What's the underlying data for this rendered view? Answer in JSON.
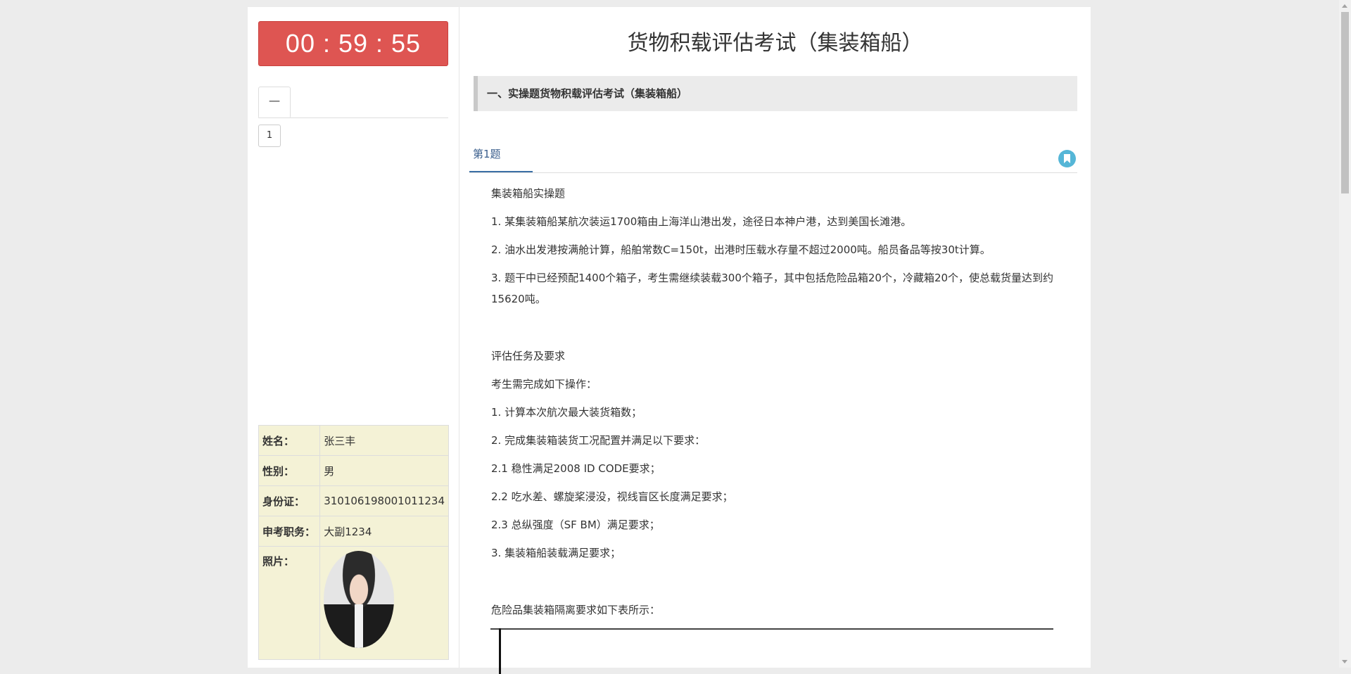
{
  "timer": {
    "value": "00 : 59 : 55"
  },
  "question_nav": {
    "tabs": [
      {
        "label": "一"
      }
    ],
    "buttons": [
      {
        "label": "1"
      }
    ]
  },
  "candidate": {
    "rows": [
      {
        "key": "姓名：",
        "value": "张三丰"
      },
      {
        "key": "性别：",
        "value": "男"
      },
      {
        "key": "身份证：",
        "value": "310106198001011234"
      },
      {
        "key": "申考职务：",
        "value": "大副1234"
      }
    ],
    "photo_label": "照片："
  },
  "exam": {
    "title": "货物积载评估考试（集装箱船）",
    "section_title": "一、实操题货物积载评估考试（集装箱船）",
    "question_label": "第1题",
    "bookmark_icon": "bookmark-icon",
    "paragraphs": [
      "集装箱船实操题",
      "1. 某集装箱船某航次装运1700箱由上海洋山港出发，途径日本神户港，达到美国长滩港。",
      "2. 油水出发港按满舱计算，船舶常数C=150t，出港时压载水存量不超过2000吨。船员备品等按30t计算。",
      "3. 题干中已经预配1400个箱子，考生需继续装载300个箱子，其中包括危险品箱20个，冷藏箱20个，使总载货量达到约15620吨。"
    ],
    "tasks_title": "评估任务及要求",
    "tasks": [
      "考生需完成如下操作：",
      "1. 计算本次航次最大装货箱数；",
      "2. 完成集装箱装货工况配置并满足以下要求：",
      "2.1 稳性满足2008 ID CODE要求；",
      "2.2 吃水差、螺旋桨浸没，视线盲区长度满足要求；",
      "2.3 总纵强度（SF BM）满足要求；",
      "3. 集装箱船装载满足要求；"
    ],
    "dg_note": "危险品集装箱隔离要求如下表所示："
  },
  "colors": {
    "timer_bg": "#de5552",
    "info_table_bg": "#f4f2d6",
    "section_bg": "#ebebeb",
    "question_tab_accent": "#3a6fa5",
    "bookmark_bg": "#55b6d7"
  }
}
